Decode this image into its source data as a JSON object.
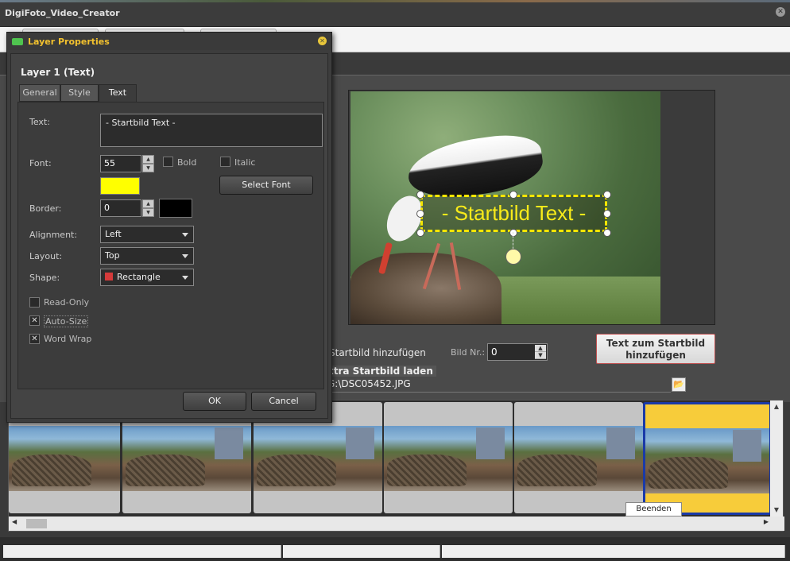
{
  "app": {
    "title": "DigiFoto_Video_Creator"
  },
  "preview": {
    "overlay_text": "- Startbild Text -"
  },
  "controls": {
    "add_startbild_label": "Startbild hinzufügen",
    "bild_nr_label": "Bild Nr.:",
    "bild_nr_value": "0",
    "add_text_button_line1": "Text zum Startbild",
    "add_text_button_line2": "hinzufügen",
    "extra_startbild_label": "xtra Startbild laden",
    "path_value": "G:\\DSC05452.JPG"
  },
  "filmstrip": {
    "thumb_count": 6,
    "selected_index": 5,
    "tooltip": "Beenden"
  },
  "dialog": {
    "title": "Layer Properties",
    "layer_title": "Layer 1 (Text)",
    "tabs": [
      "General",
      "Style",
      "Text"
    ],
    "active_tab": "Text",
    "text_label": "Text:",
    "text_value": "- Startbild Text -",
    "font_label": "Font:",
    "font_size": "55",
    "bold_label": "Bold",
    "italic_label": "Italic",
    "select_font_button": "Select Font",
    "font_color": "#ffff00",
    "border_label": "Border:",
    "border_value": "0",
    "border_color": "#000000",
    "alignment_label": "Alignment:",
    "alignment_value": "Left",
    "layout_label": "Layout:",
    "layout_value": "Top",
    "shape_label": "Shape:",
    "shape_value": "Rectangle",
    "shape_color": "#d43a3a",
    "read_only_label": "Read-Only",
    "read_only_checked": false,
    "auto_size_label": "Auto-Size",
    "auto_size_checked": true,
    "word_wrap_label": "Word Wrap",
    "word_wrap_checked": true,
    "ok_button": "OK",
    "cancel_button": "Cancel"
  }
}
